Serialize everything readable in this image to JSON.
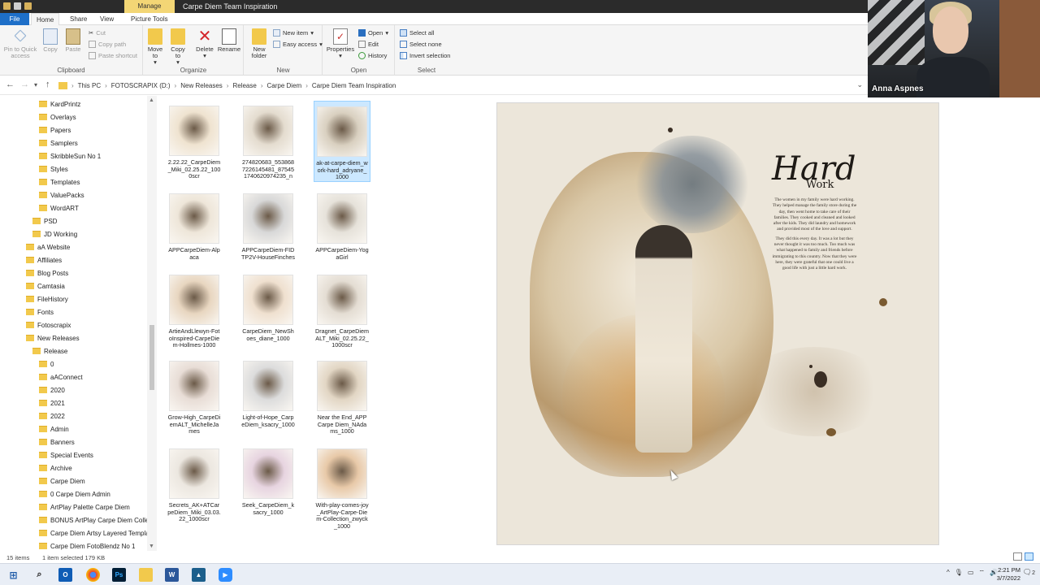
{
  "window": {
    "title": "Carpe Diem Team Inspiration",
    "context_tab": "Manage"
  },
  "ribbon_tabs": [
    "File",
    "Home",
    "Share",
    "View",
    "Picture Tools"
  ],
  "ribbon": {
    "clipboard": {
      "group": "Clipboard",
      "pin": "Pin to Quick access",
      "copy": "Copy",
      "paste": "Paste",
      "cut": "Cut",
      "copy_path": "Copy path",
      "paste_shortcut": "Paste shortcut"
    },
    "organize": {
      "group": "Organize",
      "move_to": "Move to",
      "copy_to": "Copy to",
      "delete": "Delete",
      "rename": "Rename"
    },
    "new": {
      "group": "New",
      "new_folder": "New folder",
      "new_item": "New item",
      "easy_access": "Easy access"
    },
    "open": {
      "group": "Open",
      "properties": "Properties",
      "open": "Open",
      "edit": "Edit",
      "history": "History"
    },
    "select": {
      "group": "Select",
      "select_all": "Select all",
      "select_none": "Select none",
      "invert": "Invert selection"
    }
  },
  "address": {
    "crumbs": [
      "This PC",
      "FOTOSCRAPIX (D:)",
      "New Releases",
      "Release",
      "Carpe Diem",
      "Carpe Diem Team Inspiration"
    ]
  },
  "webcam": {
    "name": "Anna Aspnes"
  },
  "tree": [
    "KardPrintz",
    "Overlays",
    "Papers",
    "Samplers",
    "SkribbleSun No 1",
    "Styles",
    "Templates",
    "ValuePacks",
    "WordART",
    "PSD",
    "JD Working",
    "aA Website",
    "Affiliates",
    "Blog Posts",
    "Camtasia",
    "FileHistory",
    "Fonts",
    "Fotoscrapix",
    "New Releases",
    "Release",
    "0",
    "aAConnect",
    "2020",
    "2021",
    "2022",
    "Admin",
    "Banners",
    "Special Events",
    "Archive",
    "Carpe Diem",
    "0 Carpe Diem Admin",
    "ArtPlay Palette Carpe Diem",
    "BONUS ArtPlay Carpe Diem Collec",
    "Carpe Diem Artsy Layered Templat",
    "Carpe Diem FotoBlendz No 1"
  ],
  "files": [
    "2.22.22_CarpeDiem_Miki_02.25.22_1000scr",
    "274820683_553868722614548​1_875451740620974235_n",
    "ak-at-carpe-diem_work-hard_adryane_1000",
    "APPCarpeDiem-Alpaca",
    "APPCarpeDiem-FIDTP2V-HouseFinches",
    "APPCarpeDiem-YogaGirl",
    "ArtieAndLlewyn-FotoInspired-CarpeDiem-Hollmes-1000",
    "CarpeDiem_NewShoes_diane_1000",
    "Dragnet_CarpeDiemALT_Miki_02.25.22_1000scr",
    "Grow-High_CarpeDiemALT_MichelleJames",
    "Light-of-Hope_CarpeDiem_ksacry_1000",
    "Near the End_APP Carpe Diem_NAdams_1000",
    "Secrets_AK+ATCarpeDiem_Miki_03.03.22_1000scr",
    "Seek_CarpeDiem_ksacry_1000",
    "With-play-comes-joy_ArtPlay-Carpe-Diem-Collection_zwyck_1000"
  ],
  "preview": {
    "title_script": "Hard",
    "title_word": "Work",
    "para1": "The women in my family were hard working. They helped manage the family store during the day, then went home to take care of their families. They cooked and cleaned and looked after the kids. They did laundry and homework and provided most of the love and support.",
    "para2": "They did this every day. It was a lot but they never thought it was too much. Too much was what happened to family and friends before immigrating to this country. Now that they were here, they were grateful that one could live a good life with just a little hard work."
  },
  "status": {
    "count": "15 items",
    "selected": "1 item selected  179 KB"
  },
  "clock": {
    "time": "2:21 PM",
    "date": "3/7/2022"
  },
  "notifications": "2",
  "colors": {
    "accent": "#1e6fc8",
    "selection": "#cce8ff",
    "folder": "#f2c94c",
    "manage_tab": "#f3d675"
  }
}
